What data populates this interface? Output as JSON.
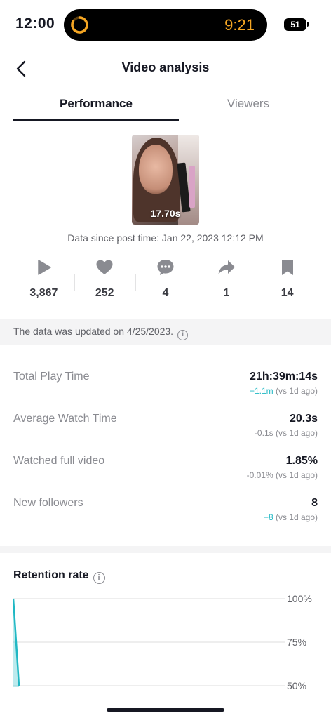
{
  "status_bar": {
    "time": "12:00",
    "island_timer": "9:21",
    "battery": "51"
  },
  "header": {
    "title": "Video analysis"
  },
  "tabs": [
    {
      "label": "Performance",
      "active": true
    },
    {
      "label": "Viewers",
      "active": false
    }
  ],
  "video": {
    "duration": "17.70s",
    "post_time_text": "Data since post time: Jan 22, 2023 12:12 PM"
  },
  "engagement": [
    {
      "icon": "play-icon",
      "value": "3,867"
    },
    {
      "icon": "heart-icon",
      "value": "252"
    },
    {
      "icon": "comment-icon",
      "value": "4"
    },
    {
      "icon": "share-icon",
      "value": "1"
    },
    {
      "icon": "bookmark-icon",
      "value": "14"
    }
  ],
  "notice": {
    "text": "The data was updated on 4/25/2023."
  },
  "metrics": [
    {
      "label": "Total Play Time",
      "value": "21h:39m:14s",
      "delta": "+1.1m",
      "delta_suffix": "(vs 1d ago)",
      "delta_positive": true
    },
    {
      "label": "Average Watch Time",
      "value": "20.3s",
      "delta": "-0.1s",
      "delta_suffix": "(vs 1d ago)",
      "delta_positive": false
    },
    {
      "label": "Watched full video",
      "value": "1.85%",
      "delta": "-0.01%",
      "delta_suffix": "(vs 1d ago)",
      "delta_positive": false
    },
    {
      "label": "New followers",
      "value": "8",
      "delta": "+8",
      "delta_suffix": "(vs 1d ago)",
      "delta_positive": true
    }
  ],
  "retention": {
    "title": "Retention rate",
    "y_ticks": [
      "100%",
      "75%",
      "50%"
    ]
  },
  "colors": {
    "accent_teal": "#20b8c4",
    "island_timer": "#f5a623",
    "text_primary": "#161823",
    "text_secondary": "#8a8b91"
  },
  "chart_data": {
    "type": "area",
    "title": "Retention rate",
    "ylim": [
      50,
      100
    ],
    "y_tick_labels": [
      "100%",
      "75%",
      "50%"
    ],
    "x": [
      0,
      1,
      2
    ],
    "values": [
      100,
      75,
      50
    ]
  }
}
